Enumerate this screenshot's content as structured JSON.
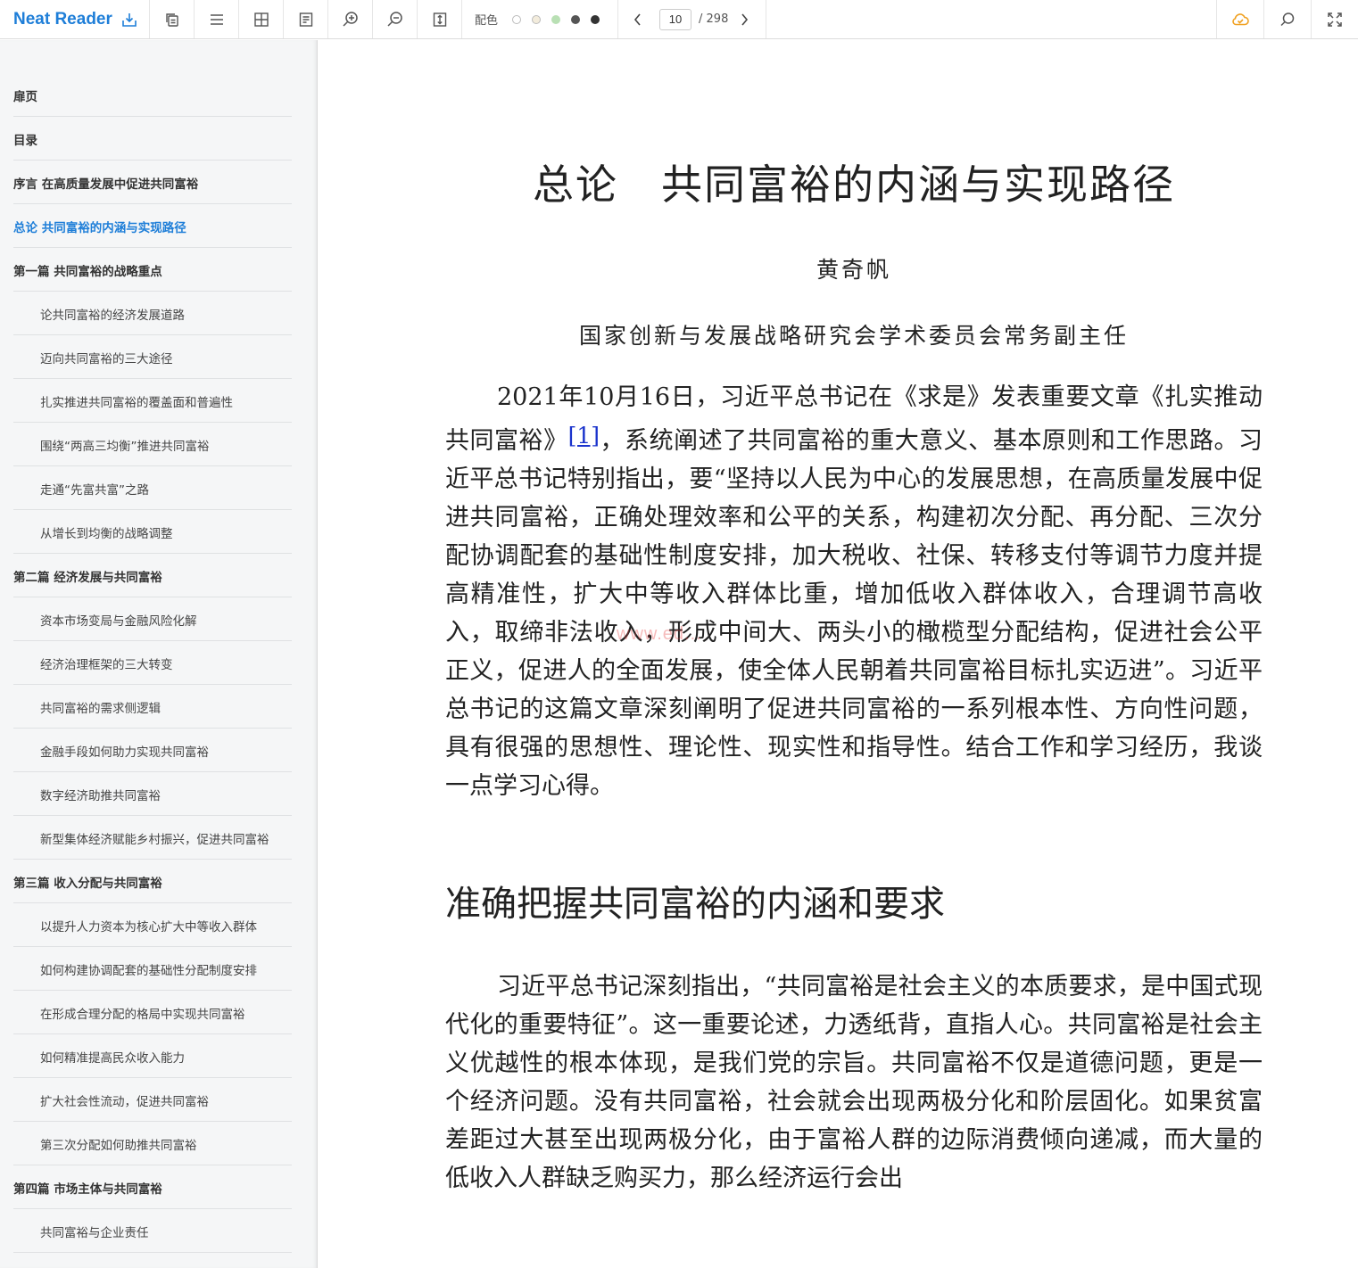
{
  "app": {
    "name": "Neat Reader"
  },
  "toolbar": {
    "color_label": "配色",
    "color_swatches": [
      "#ffffff",
      "#f3ecdc",
      "#b9e0b4",
      "#555555",
      "#333333"
    ],
    "current_page": "10",
    "total_pages": "/ 298"
  },
  "sidebar": {
    "items": [
      {
        "label": "扉页",
        "level": 1
      },
      {
        "label": "目录",
        "level": 1
      },
      {
        "label": "序言 在高质量发展中促进共同富裕",
        "level": 1
      },
      {
        "label": "总论 共同富裕的内涵与实现路径",
        "level": 1,
        "active": true
      },
      {
        "label": "第一篇 共同富裕的战略重点",
        "level": 1
      },
      {
        "label": "论共同富裕的经济发展道路",
        "level": 2
      },
      {
        "label": "迈向共同富裕的三大途径",
        "level": 2
      },
      {
        "label": "扎实推进共同富裕的覆盖面和普遍性",
        "level": 2
      },
      {
        "label": "围绕“两高三均衡”推进共同富裕",
        "level": 2
      },
      {
        "label": "走通“先富共富”之路",
        "level": 2
      },
      {
        "label": "从增长到均衡的战略调整",
        "level": 2
      },
      {
        "label": "第二篇 经济发展与共同富裕",
        "level": 1
      },
      {
        "label": "资本市场变局与金融风险化解",
        "level": 2
      },
      {
        "label": "经济治理框架的三大转变",
        "level": 2
      },
      {
        "label": "共同富裕的需求侧逻辑",
        "level": 2
      },
      {
        "label": "金融手段如何助力实现共同富裕",
        "level": 2
      },
      {
        "label": "数字经济助推共同富裕",
        "level": 2
      },
      {
        "label": "新型集体经济赋能乡村振兴，促进共同富裕",
        "level": 2
      },
      {
        "label": "第三篇 收入分配与共同富裕",
        "level": 1
      },
      {
        "label": "以提升人力资本为核心扩大中等收入群体",
        "level": 2
      },
      {
        "label": "如何构建协调配套的基础性分配制度安排",
        "level": 2
      },
      {
        "label": "在形成合理分配的格局中实现共同富裕",
        "level": 2
      },
      {
        "label": "如何精准提高民众收入能力",
        "level": 2
      },
      {
        "label": "扩大社会性流动，促进共同富裕",
        "level": 2
      },
      {
        "label": "第三次分配如何助推共同富裕",
        "level": 2
      },
      {
        "label": "第四篇 市场主体与共同富裕",
        "level": 1
      },
      {
        "label": "共同富裕与企业责任",
        "level": 2
      }
    ]
  },
  "content": {
    "chapter_title": "总论　共同富裕的内涵与实现路径",
    "author": "黄奇帆",
    "affiliation": "国家创新与发展战略研究会学术委员会常务副主任",
    "p1_before": "2021年10月16日，习近平总书记在《求是》发表重要文章《扎实推动共同富裕》",
    "footnote": "[1]",
    "p1_after": "，系统阐述了共同富裕的重大意义、基本原则和工作思路。习近平总书记特别指出，要“坚持以人民为中心的发展思想，在高质量发展中促进共同富裕，正确处理效率和公平的关系，构建初次分配、再分配、三次分配协调配套的基础性制度安排，加大税收、社保、转移支付等调节力度并提高精准性，扩大中等收入群体比重，增加低收入群体收入，合理调节高收入，取缔非法收入，形成中间大、两头小的橄榄型分配结构，促进社会公平正义，促进人的全面发展，使全体人民朝着共同富裕目标扎实迈进”。习近平总书记的这篇文章深刻阐明了促进共同富裕的一系列根本性、方向性问题，具有很强的思想性、理论性、现实性和指导性。结合工作和学习经历，我谈一点学习心得。",
    "section_title": "准确把握共同富裕的内涵和要求",
    "p2": "习近平总书记深刻指出，“共同富裕是社会主义的本质要求，是中国式现代化的重要特征”。这一重要论述，力透纸背，直指人心。共同富裕是社会主义优越性的根本体现，是我们党的宗旨。共同富裕不仅是道德问题，更是一个经济问题。没有共同富裕，社会就会出现两极分化和阶层固化。如果贫富差距过大甚至出现两极分化，由于富裕人群的边际消费倾向递减，而大量的低收入人群缺乏购买力，那么经济运行会出",
    "watermark": "www.ed..."
  }
}
